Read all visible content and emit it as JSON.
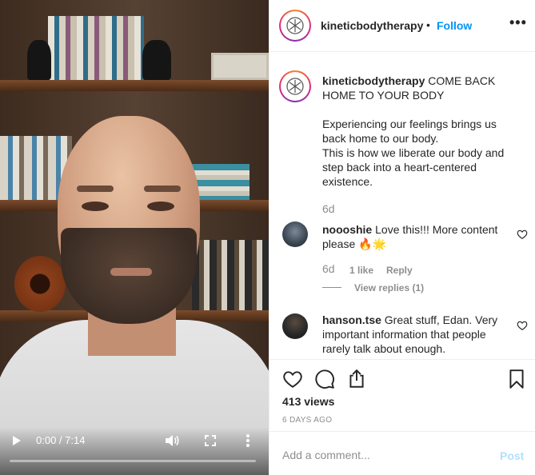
{
  "video": {
    "time_display": "0:00 / 7:14",
    "progress_fraction": 0.0
  },
  "header": {
    "username": "kineticbodytherapy",
    "separator": "•",
    "follow_label": "Follow",
    "more_label": "•••"
  },
  "caption": {
    "username": "kineticbodytherapy",
    "title": "COME BACK HOME TO YOUR BODY",
    "lines": [
      "Experiencing our feelings brings us back home to our body.",
      "This is how we liberate our body and step back into a heart-centered existence."
    ],
    "age": "6d"
  },
  "comments": [
    {
      "username": "noooshie",
      "text": "Love this!!! More content please 🔥🌟",
      "age": "6d",
      "likes": "1 like",
      "reply_label": "Reply",
      "view_replies": "View replies (1)"
    },
    {
      "username": "hanson.tse",
      "text": "Great stuff, Edan. Very important information that people rarely talk about enough."
    }
  ],
  "actions": {
    "views": "413 views",
    "posted": "6 DAYS AGO"
  },
  "add_comment": {
    "placeholder": "Add a comment...",
    "post_label": "Post"
  },
  "colors": {
    "link": "#0095f6",
    "post_disabled": "#b2dffc",
    "muted": "#8e8e8e",
    "text": "#262626"
  }
}
